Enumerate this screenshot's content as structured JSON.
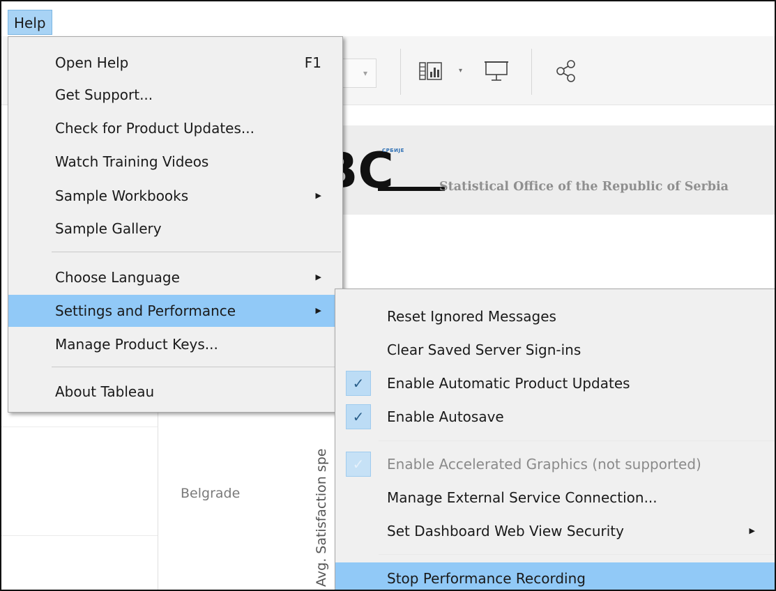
{
  "menubar": {
    "help_label": "Help"
  },
  "banner": {
    "logo_tag": "СРБИЈЕ",
    "logo_letters": "BC",
    "text": "Statistical Office of the Republic of Serbia"
  },
  "workspace": {
    "row_label": "Belgrade",
    "axis_label": "Avg. Satisfaction spe"
  },
  "help_menu": {
    "items": [
      {
        "label": "Open Help",
        "shortcut": "F1"
      },
      {
        "label": "Get Support..."
      },
      {
        "label": "Check for Product Updates..."
      },
      {
        "label": "Watch Training Videos"
      },
      {
        "label": "Sample Workbooks",
        "submenu": true
      },
      {
        "label": "Sample Gallery"
      },
      {
        "label": "Choose Language",
        "submenu": true
      },
      {
        "label": "Settings and Performance",
        "submenu": true,
        "highlighted": true
      },
      {
        "label": "Manage Product Keys..."
      },
      {
        "label": "About Tableau"
      }
    ]
  },
  "settings_menu": {
    "items": [
      {
        "label": "Reset Ignored Messages",
        "checked": false
      },
      {
        "label": "Clear Saved Server Sign-ins",
        "checked": false
      },
      {
        "label": "Enable Automatic Product Updates",
        "checked": true
      },
      {
        "label": "Enable Autosave",
        "checked": true
      },
      {
        "label": "Enable Accelerated Graphics (not supported)",
        "checked": true,
        "disabled": true
      },
      {
        "label": "Manage External Service Connection...",
        "checked": false
      },
      {
        "label": "Set Dashboard Web View Security",
        "submenu": true
      },
      {
        "label": "Stop Performance Recording",
        "highlighted": true
      }
    ]
  },
  "icons": {
    "arrow": "▶",
    "check": "✓",
    "caret": "▾"
  },
  "colors": {
    "highlight": "#91c9f7",
    "menu_bg": "#f0f0f0",
    "check_bg": "#bcdcf5"
  }
}
